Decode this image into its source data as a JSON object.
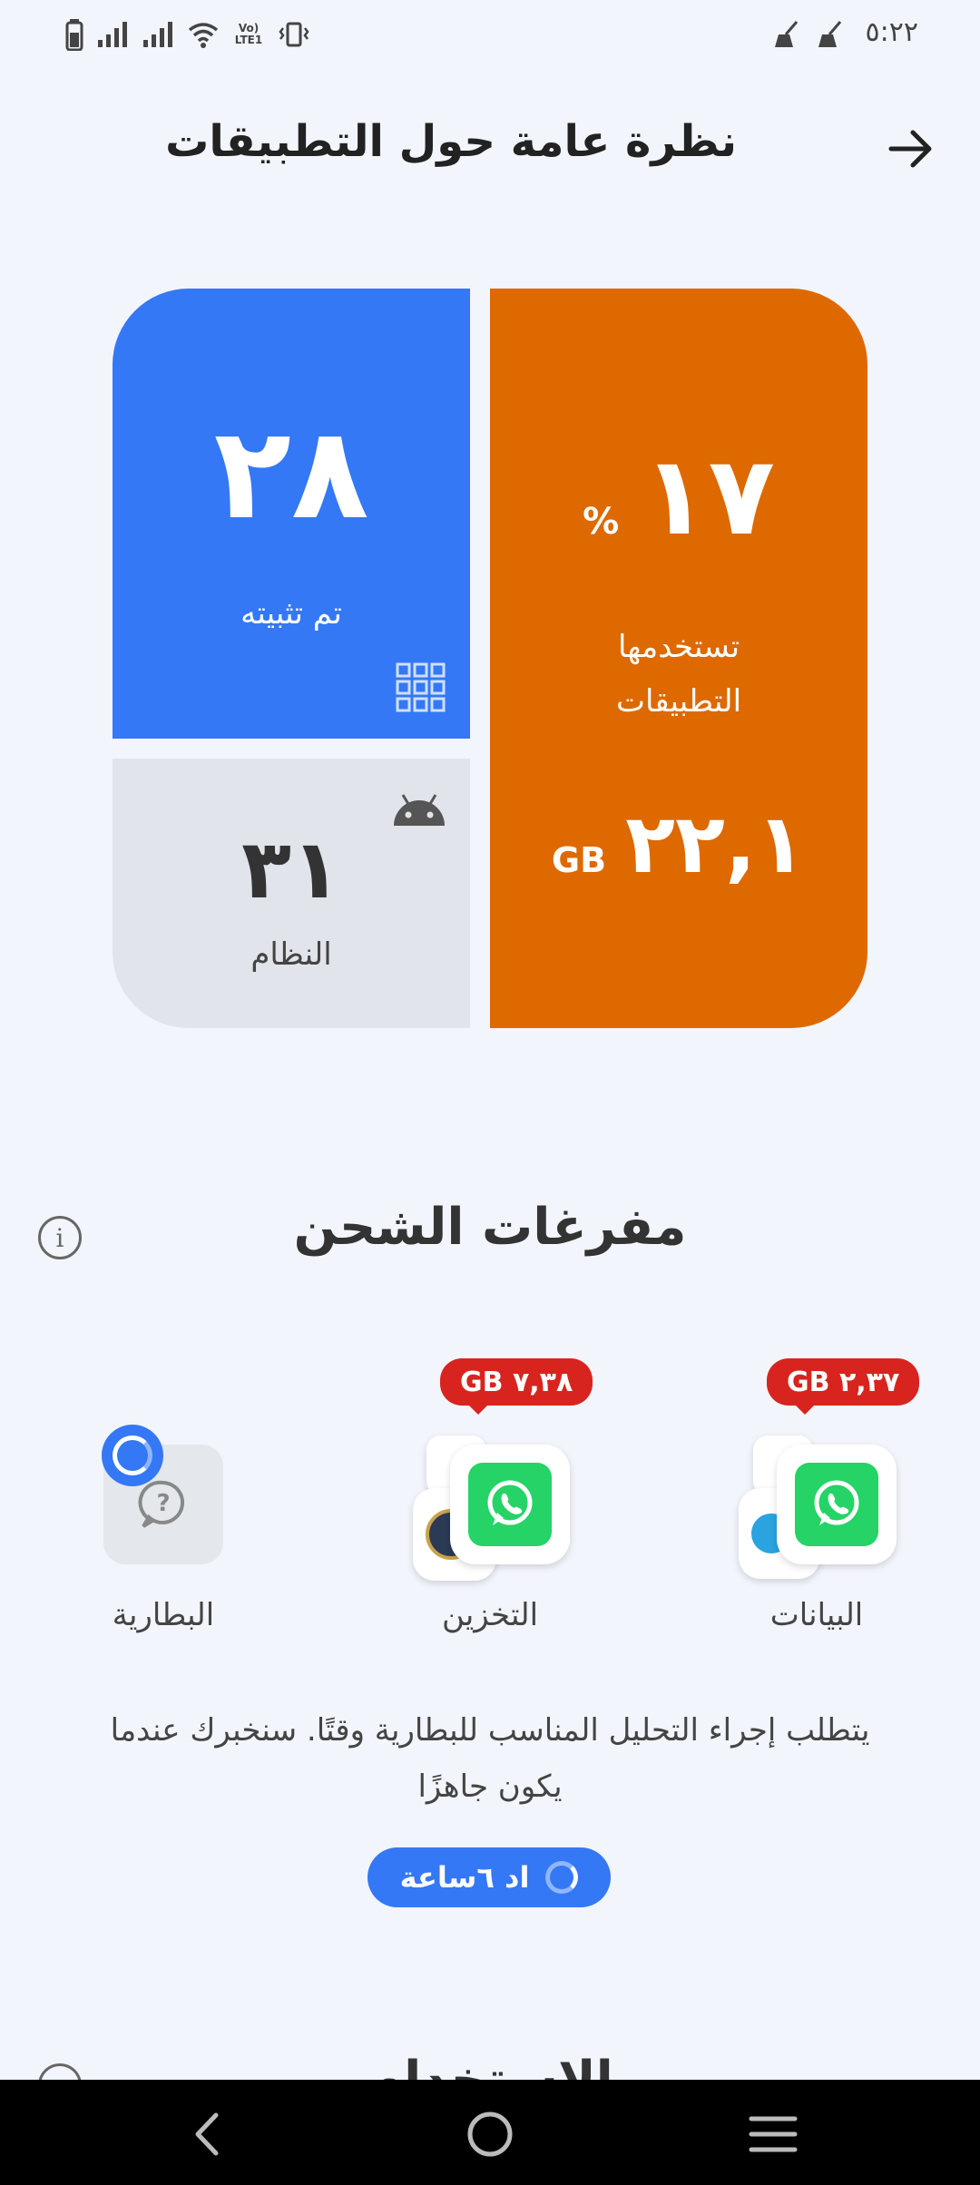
{
  "status_bar": {
    "time": "٥:٢٢",
    "left_icons": [
      "battery-icon",
      "signal-icon",
      "signal-icon",
      "wifi-icon",
      "volte-icon",
      "vibrate-icon"
    ],
    "volte_label": "Vo) LTE1",
    "right_icons": [
      "broom-icon",
      "broom-icon"
    ]
  },
  "header": {
    "title": "نظرة عامة حول التطبيقات",
    "back_icon": "arrow-icon"
  },
  "cards": {
    "installed": {
      "value": "٢٨",
      "label": "تم تثبيته",
      "icon": "grid-icon",
      "color": "#3478f6"
    },
    "system": {
      "value": "٣١",
      "label": "النظام",
      "icon": "android-icon",
      "color": "#e1e4ea"
    },
    "used": {
      "percent_value": "١٧",
      "percent_sign": "%",
      "label_line1": "تستخدمها",
      "label_line2": "التطبيقات",
      "size_value": "٢٢,١",
      "size_unit": "GB",
      "color": "#dd6900"
    }
  },
  "drainers": {
    "title": "مفرغات الشحن",
    "info_icon": "info-icon",
    "items": [
      {
        "label": "البيانات",
        "badge": "GB ٢,٣٧",
        "icon": "whatsapp-icon"
      },
      {
        "label": "التخزين",
        "badge": "GB ٧,٣٨",
        "icon": "whatsapp-icon"
      },
      {
        "label": "البطارية",
        "icon": "question-bubble-icon"
      }
    ],
    "description": "يتطلب إجراء التحليل المناسب للبطارية وقتًا. سنخبرك عندما يكون جاهزًا",
    "pill_label": "اد ٦ساعة"
  },
  "next_section": {
    "title_partial": "الاستخدام"
  },
  "navbar": {
    "back": "back-icon",
    "home": "home-icon",
    "recents": "menu-icon"
  }
}
